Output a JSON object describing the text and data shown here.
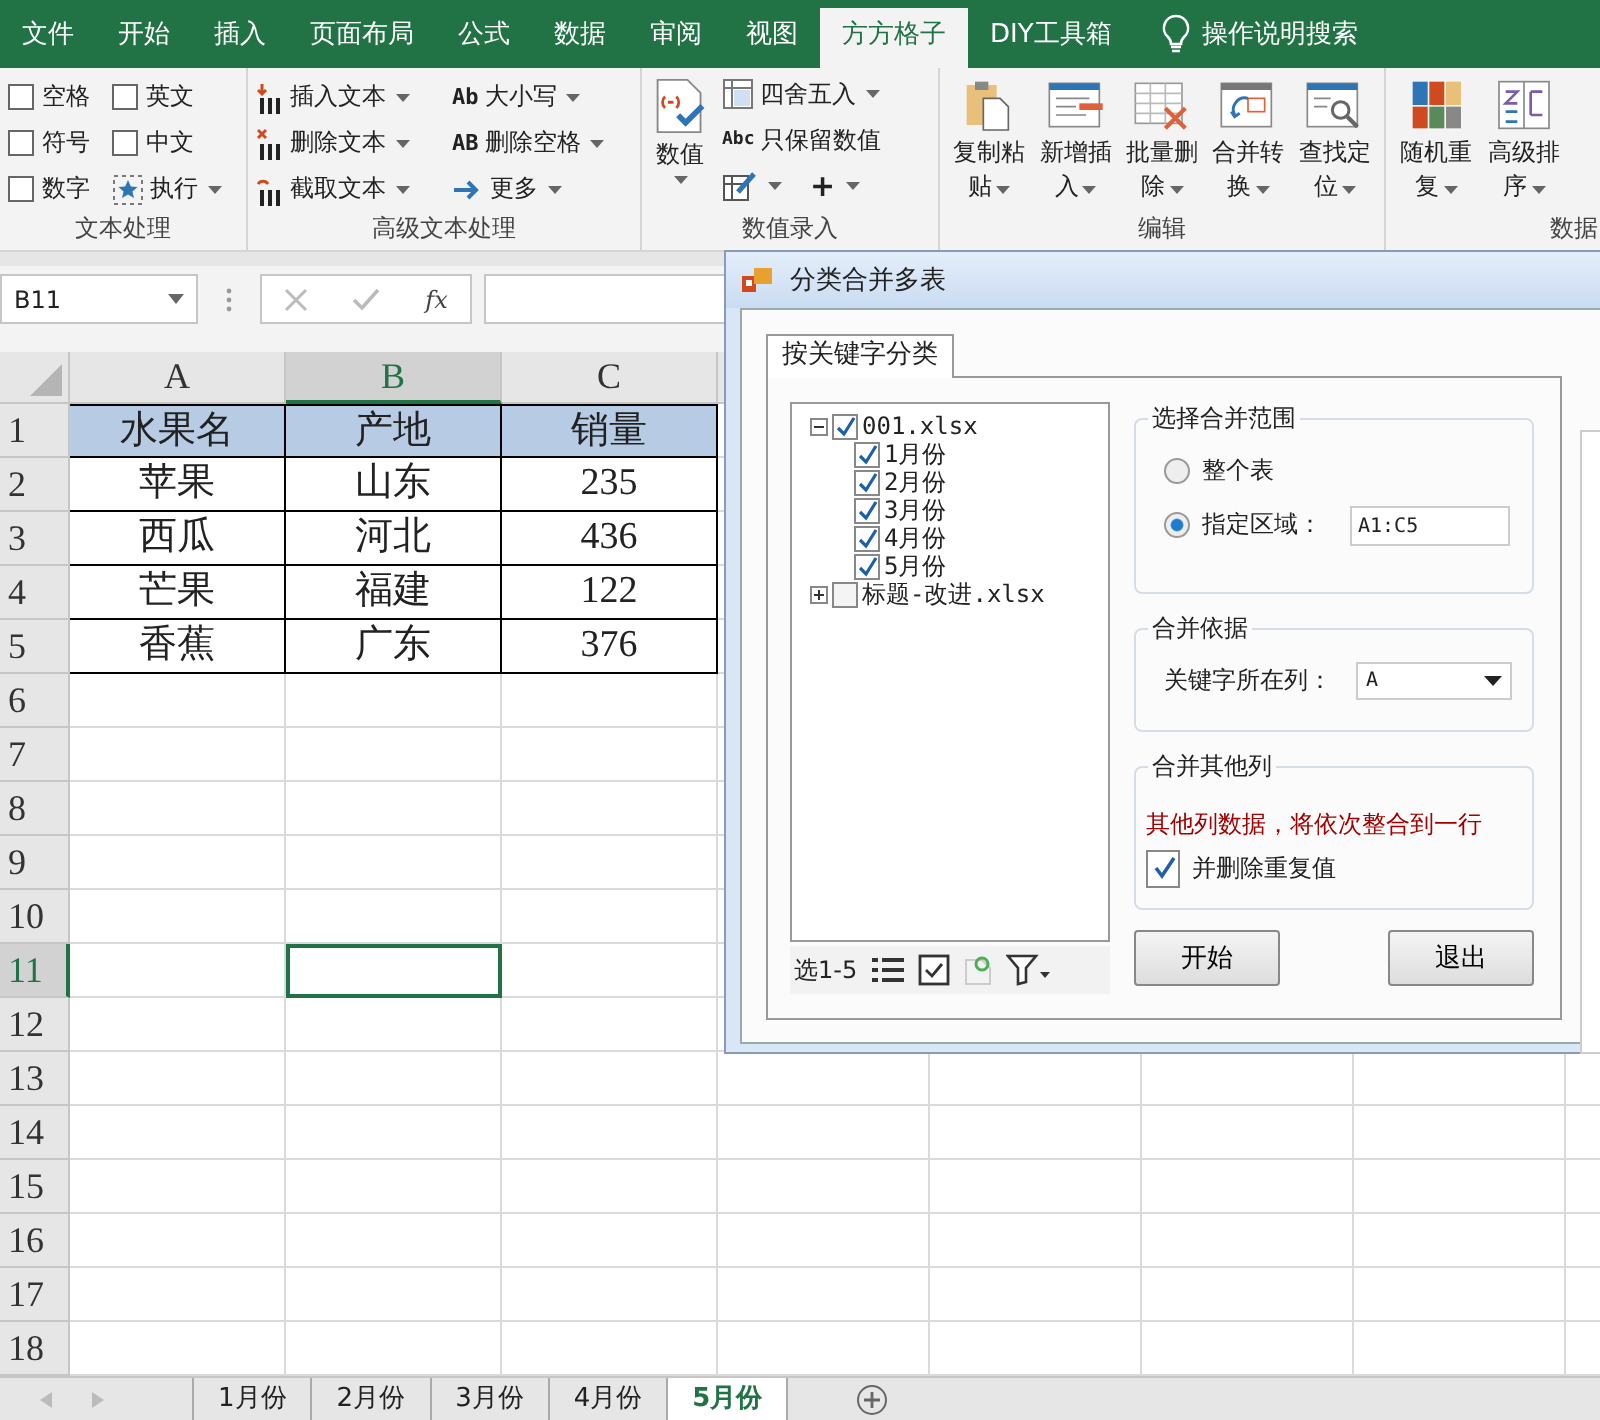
{
  "menu_tabs": [
    {
      "label": "文件",
      "selected": false
    },
    {
      "label": "开始",
      "selected": false
    },
    {
      "label": "插入",
      "selected": false
    },
    {
      "label": "页面布局",
      "selected": false
    },
    {
      "label": "公式",
      "selected": false
    },
    {
      "label": "数据",
      "selected": false
    },
    {
      "label": "审阅",
      "selected": false
    },
    {
      "label": "视图",
      "selected": false
    },
    {
      "label": "方方格子",
      "selected": true
    },
    {
      "label": "DIY工具箱",
      "selected": false
    }
  ],
  "tell_me": "操作说明搜索",
  "ribbon": {
    "text_group": {
      "title": "文本处理",
      "options": [
        {
          "label": "空格",
          "checked": false
        },
        {
          "label": "英文",
          "checked": false
        },
        {
          "label": "符号",
          "checked": false
        },
        {
          "label": "中文",
          "checked": false
        },
        {
          "label": "数字",
          "checked": false
        }
      ],
      "run_button": "执行"
    },
    "advanced_text": {
      "title": "高级文本处理",
      "commands": [
        {
          "label": "插入文本"
        },
        {
          "label": "删除文本"
        },
        {
          "label": "截取文本"
        },
        {
          "label": "大小写",
          "glyph": "Ab"
        },
        {
          "label": "删除空格",
          "glyph": "AB"
        },
        {
          "label": "更多"
        }
      ]
    },
    "number_entry": {
      "title": "数值录入",
      "large_button": "数值",
      "commands": [
        {
          "kind": "text",
          "label": "四舍五入",
          "dropdown": true
        },
        {
          "kind": "text",
          "label": "只保留数值",
          "glyph": "Abc",
          "dropdown": false
        },
        {
          "kind": "icon",
          "dropdown": true
        },
        {
          "kind": "symbol",
          "label": "+",
          "dropdown": true
        }
      ]
    },
    "edit": {
      "title": "编辑",
      "buttons": [
        "复制粘贴",
        "新增插入",
        "批量删除",
        "合并转换",
        "查找定位"
      ]
    },
    "data": {
      "title": "数据",
      "buttons": [
        "随机重复",
        "高级排序"
      ]
    }
  },
  "formula_bar": {
    "name_box": "B11",
    "function_label": "fx"
  },
  "columns": [
    {
      "label": "A",
      "selected": false
    },
    {
      "label": "B",
      "selected": true
    },
    {
      "label": "C",
      "selected": false
    }
  ],
  "rows": [
    {
      "number": "1",
      "kind": "header",
      "selected": false,
      "cells": [
        "水果名",
        "产地",
        "销量"
      ]
    },
    {
      "number": "2",
      "kind": "data",
      "selected": false,
      "cells": [
        "苹果",
        "山东",
        "235"
      ]
    },
    {
      "number": "3",
      "kind": "data",
      "selected": false,
      "cells": [
        "西瓜",
        "河北",
        "436"
      ]
    },
    {
      "number": "4",
      "kind": "data",
      "selected": false,
      "cells": [
        "芒果",
        "福建",
        "122"
      ]
    },
    {
      "number": "5",
      "kind": "data",
      "selected": false,
      "cells": [
        "香蕉",
        "广东",
        "376"
      ]
    },
    {
      "number": "6",
      "kind": "blank",
      "selected": false
    },
    {
      "number": "7",
      "kind": "blank",
      "selected": false
    },
    {
      "number": "8",
      "kind": "blank",
      "selected": false
    },
    {
      "number": "9",
      "kind": "blank",
      "selected": false
    },
    {
      "number": "10",
      "kind": "blank",
      "selected": false
    },
    {
      "number": "11",
      "kind": "blank",
      "selected": true
    },
    {
      "number": "12",
      "kind": "blank",
      "selected": false
    },
    {
      "number": "13",
      "kind": "blank",
      "selected": false
    },
    {
      "number": "14",
      "kind": "blank",
      "selected": false
    },
    {
      "number": "15",
      "kind": "blank",
      "selected": false
    },
    {
      "number": "16",
      "kind": "blank",
      "selected": false
    },
    {
      "number": "17",
      "kind": "blank",
      "selected": false
    },
    {
      "number": "18",
      "kind": "blank",
      "selected": false
    }
  ],
  "sheet_tabs": [
    {
      "label": "1月份",
      "selected": false
    },
    {
      "label": "2月份",
      "selected": false
    },
    {
      "label": "3月份",
      "selected": false
    },
    {
      "label": "4月份",
      "selected": false
    },
    {
      "label": "5月份",
      "selected": true
    }
  ],
  "dialog": {
    "title": "分类合并多表",
    "tabs": [
      {
        "label": "按关键字分类",
        "selected": true
      }
    ],
    "tree": [
      {
        "label": "001.xlsx",
        "checked": true,
        "expanded": true,
        "children": [
          {
            "label": "1月份",
            "checked": true
          },
          {
            "label": "2月份",
            "checked": true
          },
          {
            "label": "3月份",
            "checked": true
          },
          {
            "label": "4月份",
            "checked": true
          },
          {
            "label": "5月份",
            "checked": true
          }
        ]
      },
      {
        "label": "标题-改进.xlsx",
        "checked": false,
        "expanded": false
      }
    ],
    "tree_toolbar": "选1-5",
    "range_group": {
      "title": "选择合并范围",
      "options": [
        {
          "label": "整个表",
          "selected": false
        },
        {
          "label": "指定区域：",
          "selected": true
        }
      ],
      "range_value": "A1:C5"
    },
    "basis_group": {
      "title": "合并依据",
      "label": "关键字所在列：",
      "value": "A"
    },
    "other_group": {
      "title": "合并其他列",
      "note": "其他列数据，将依次整合到一行",
      "option": {
        "label": "并删除重复值",
        "checked": true
      }
    },
    "buttons": [
      "开始",
      "退出"
    ]
  }
}
